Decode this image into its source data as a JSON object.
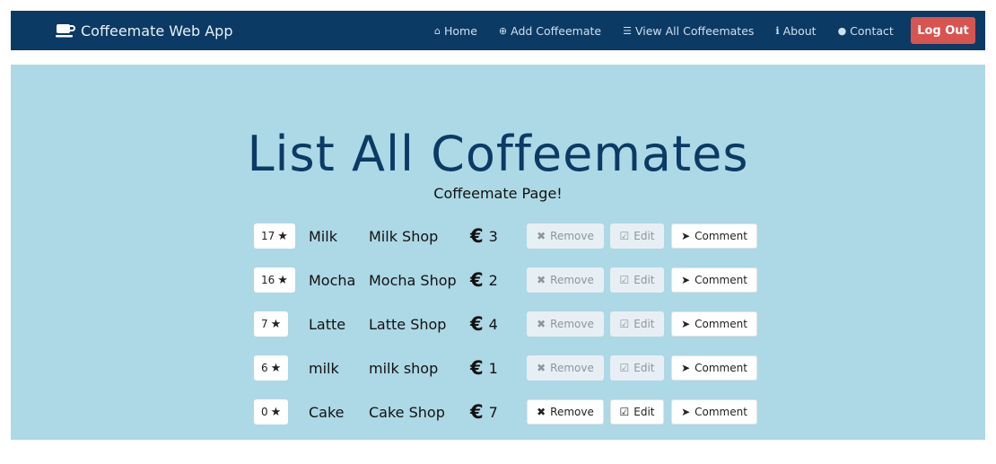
{
  "navbar": {
    "brand": "Coffeemate Web App",
    "items": [
      {
        "icon": "home-icon",
        "glyph": "⌂",
        "label": "Home"
      },
      {
        "icon": "plus-circle-icon",
        "glyph": "⊕",
        "label": "Add Coffeemate"
      },
      {
        "icon": "list-icon",
        "glyph": "☰",
        "label": "View All Coffeemates"
      },
      {
        "icon": "info-icon",
        "glyph": "i",
        "label": "About"
      },
      {
        "icon": "comment-icon",
        "glyph": "●",
        "label": "Contact"
      }
    ],
    "logout": "Log Out",
    "logout_color": "#d9534f",
    "bar_color": "#0b3a64"
  },
  "main": {
    "title": "List All Coffeemates",
    "subtitle": "Coffeemate Page!",
    "background": "#add8e6"
  },
  "actions": {
    "remove": "Remove",
    "edit": "Edit",
    "comment": "Comment",
    "currency": "€"
  },
  "coffees": [
    {
      "rating": "17",
      "name": "Milk",
      "shop": "Milk Shop",
      "price": "3",
      "buttons_enabled": false
    },
    {
      "rating": "16",
      "name": "Mocha",
      "shop": "Mocha Shop",
      "price": "2",
      "buttons_enabled": false
    },
    {
      "rating": "7",
      "name": "Latte",
      "shop": "Latte Shop",
      "price": "4",
      "buttons_enabled": false
    },
    {
      "rating": "6",
      "name": "milk",
      "shop": "milk shop",
      "price": "1",
      "buttons_enabled": false
    },
    {
      "rating": "0",
      "name": "Cake",
      "shop": "Cake Shop",
      "price": "7",
      "buttons_enabled": true
    }
  ]
}
